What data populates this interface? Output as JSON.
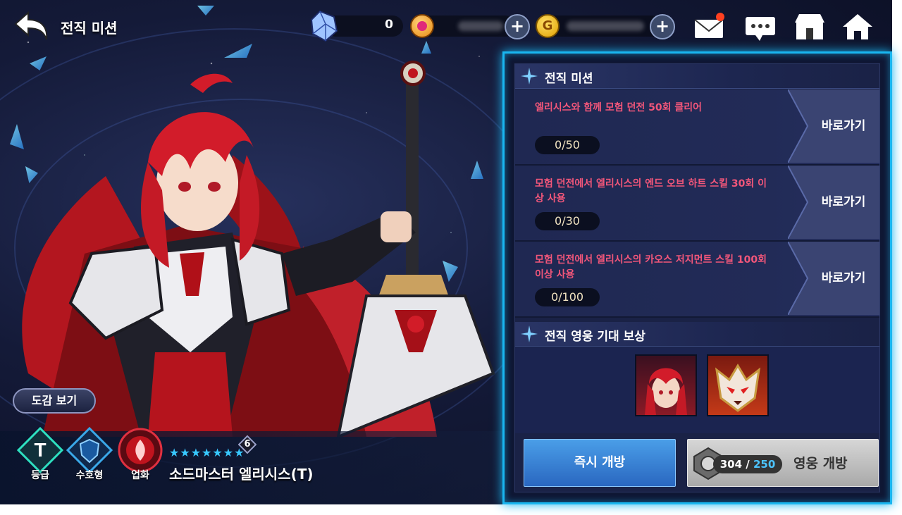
{
  "header": {
    "title": "전직 미션",
    "back_icon": "back-arrow-icon"
  },
  "currency": {
    "crystal": {
      "icon": "crystal-icon",
      "value": "0"
    },
    "ruby": {
      "icon": "ruby-coin-icon",
      "add_label": "+"
    },
    "gold": {
      "icon": "gold-coin-icon",
      "letter": "G",
      "add_label": "+"
    }
  },
  "top_icons": [
    "mail-icon",
    "chat-icon",
    "shop-icon",
    "home-icon"
  ],
  "left": {
    "codex_button": "도감 보기",
    "badges": [
      {
        "icon": "grade-t-icon",
        "letter": "T",
        "label": "등급"
      },
      {
        "icon": "guardian-shield-icon",
        "label": "수호형"
      },
      {
        "icon": "karma-emblem-icon",
        "label": "업화"
      }
    ],
    "star_count": 7,
    "level": "6",
    "hero_name": "소드마스터 엘리시스(T)"
  },
  "panel": {
    "missions_header": "전직 미션",
    "missions": [
      {
        "text": "엘리시스와 함께 모험 던전 50회 클리어",
        "progress": "0/50",
        "button": "바로가기"
      },
      {
        "text": "모험 던전에서 엘리시스의 엔드 오브 하트 스킬 30회 이상 사용",
        "progress": "0/30",
        "button": "바로가기"
      },
      {
        "text": "모험 던전에서 엘리시스의 카오스 저지먼트 스킬 100회 이상 사용",
        "progress": "0/100",
        "button": "바로가기"
      }
    ],
    "rewards_header": "전직 영웅 기대 보상",
    "rewards": [
      "hero-portrait-icon",
      "beast-portrait-icon"
    ],
    "instant_button": "즉시 개방",
    "hero_open": {
      "current": "304",
      "separator": " / ",
      "required": "250",
      "label": "영웅 개방",
      "icon": "medal-icon"
    }
  },
  "colors": {
    "accent": "#19b6f0",
    "mission_text": "#f2567a",
    "star": "#38c8ff"
  }
}
